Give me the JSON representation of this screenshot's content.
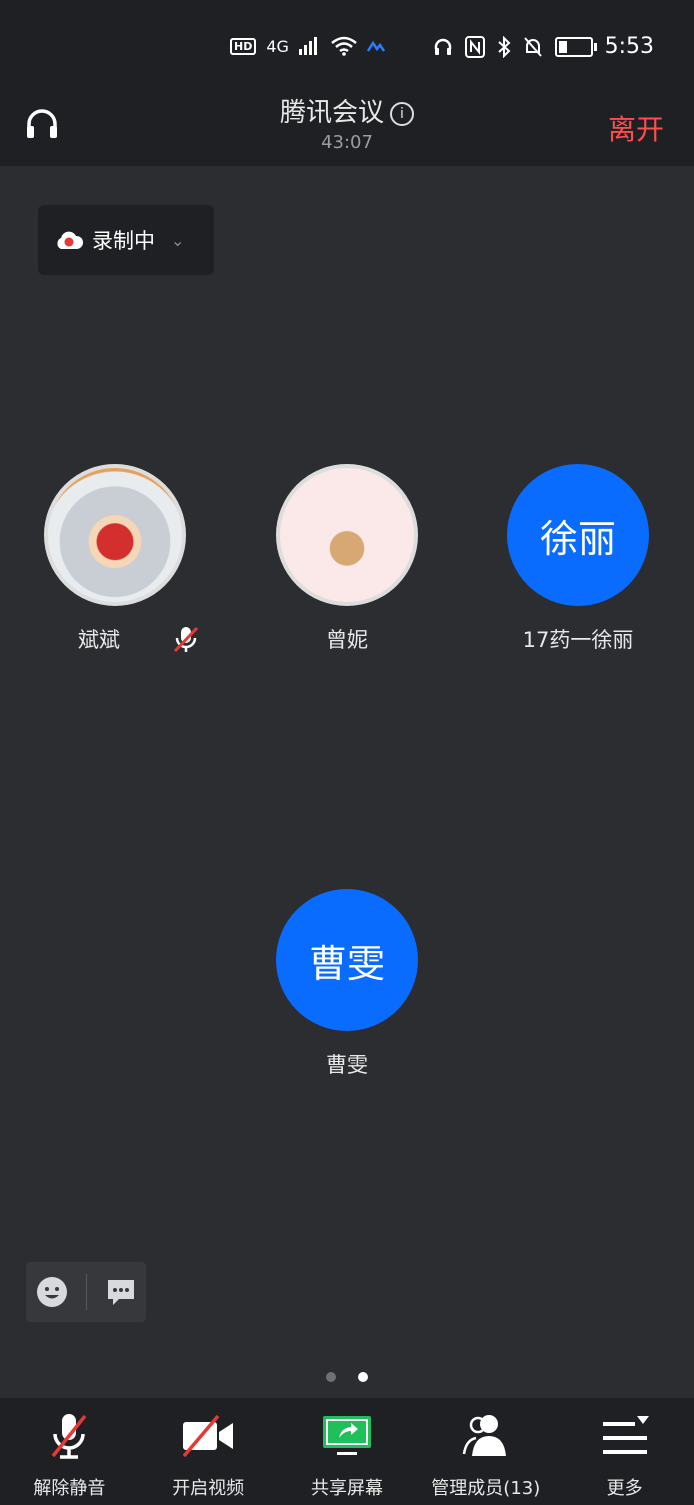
{
  "status_bar": {
    "hd": "HD",
    "net": "4G",
    "time": "5:53"
  },
  "header": {
    "title": "腾讯会议",
    "timer": "43:07",
    "leave_label": "离开"
  },
  "recording": {
    "label": "录制中"
  },
  "participants": [
    {
      "name": "斌斌",
      "avatar_text": "",
      "muted": true
    },
    {
      "name": "曾妮",
      "avatar_text": ""
    },
    {
      "name": "17药一徐丽",
      "avatar_text": "徐丽"
    },
    {
      "name": "曹雯",
      "avatar_text": "曹雯"
    }
  ],
  "pagination": {
    "pages": 2,
    "current": 2
  },
  "toolbar": {
    "unmute_label": "解除静音",
    "video_label": "开启视频",
    "share_label": "共享屏幕",
    "members_label": "管理成员(13)",
    "more_label": "更多"
  },
  "colors": {
    "accent_blue": "#0a6cff",
    "leave_red": "#ff4d4f",
    "share_green": "#1fbf5a",
    "background": "#2b2d31",
    "bar": "#1f2023"
  }
}
